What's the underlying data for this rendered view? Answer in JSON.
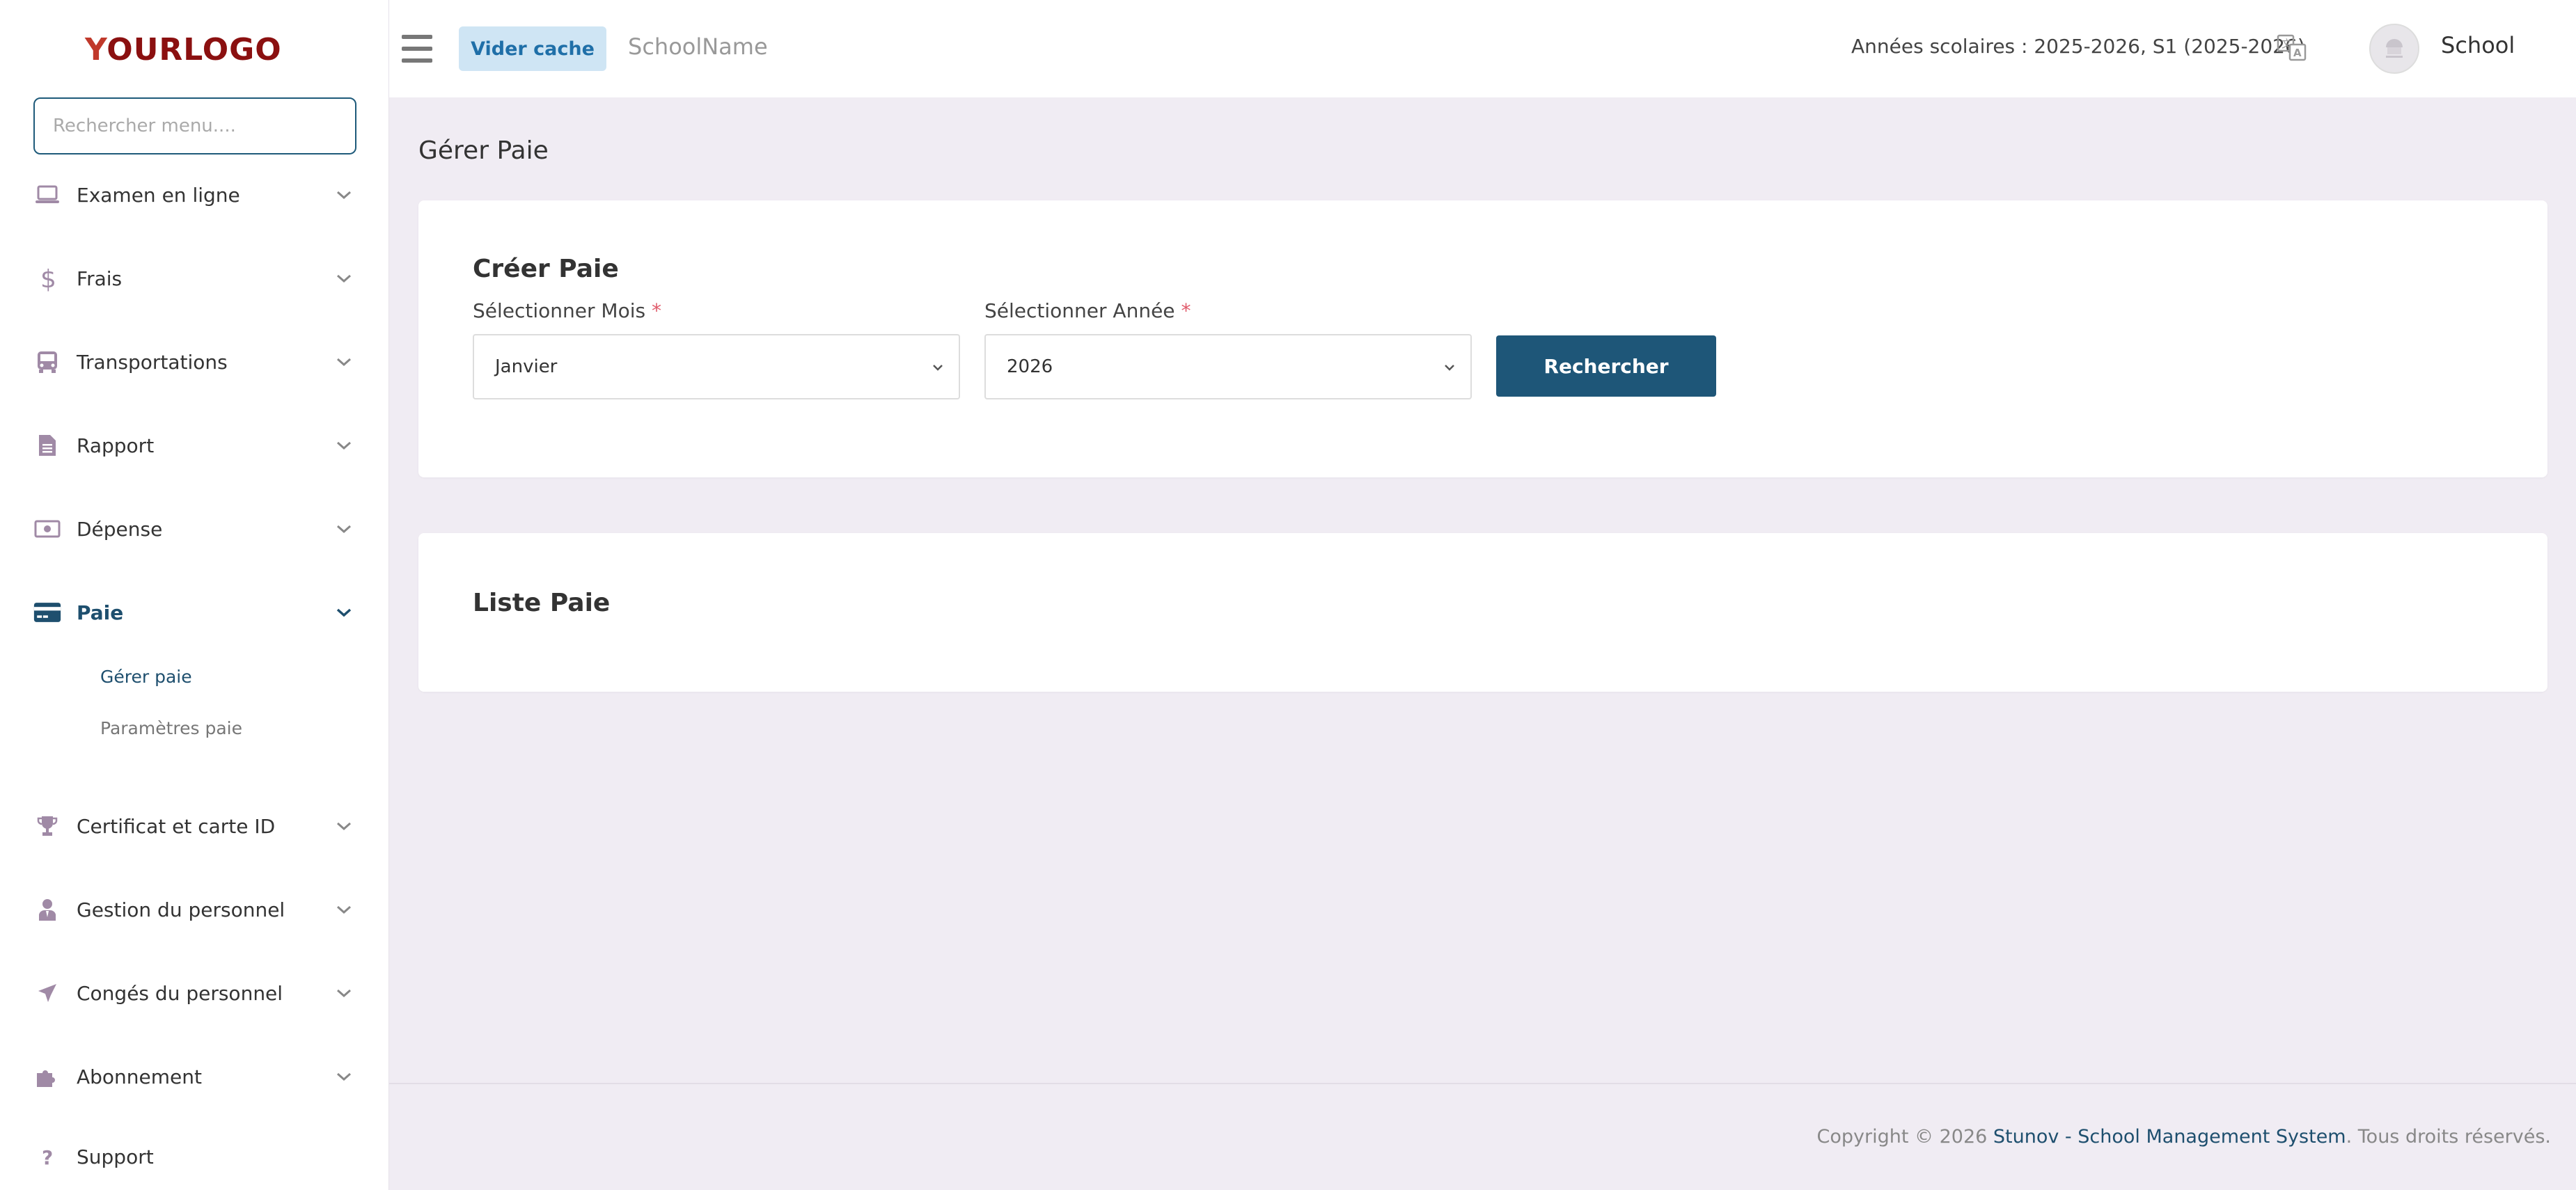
{
  "logo": {
    "first_letter": "Y",
    "rest": "OURLOGO"
  },
  "sidebar": {
    "search_placeholder": "Rechercher menu....",
    "items": [
      {
        "label": "Examen en ligne",
        "icon": "laptop-icon"
      },
      {
        "label": "Frais",
        "icon": "dollar-icon"
      },
      {
        "label": "Transportations",
        "icon": "bus-icon"
      },
      {
        "label": "Rapport",
        "icon": "document-icon"
      },
      {
        "label": "Dépense",
        "icon": "money-bill-icon"
      },
      {
        "label": "Paie",
        "icon": "credit-card-icon",
        "active": true
      },
      {
        "label": "Certificat et carte ID",
        "icon": "trophy-icon"
      },
      {
        "label": "Gestion du personnel",
        "icon": "user-tie-icon"
      },
      {
        "label": "Congés du personnel",
        "icon": "plane-icon"
      },
      {
        "label": "Abonnement",
        "icon": "puzzle-icon"
      },
      {
        "label": "Support",
        "icon": "question-icon"
      }
    ],
    "sub_items": [
      {
        "label": "Gérer paie",
        "active": true
      },
      {
        "label": "Paramètres paie"
      }
    ]
  },
  "header": {
    "clear_cache_label": "Vider cache",
    "school_name": "SchoolName",
    "academic_years": "Années scolaires : 2025-2026, S1 (2025-2026)",
    "user_name": "School"
  },
  "main": {
    "page_title": "Gérer Paie",
    "create_card": {
      "title": "Créer Paie",
      "month_label": "Sélectionner Mois",
      "month_value": "Janvier",
      "year_label": "Sélectionner Année",
      "year_value": "2026",
      "required_mark": "*",
      "search_label": "Rechercher"
    },
    "list_card": {
      "title": "Liste Paie"
    }
  },
  "footer": {
    "prefix": "Copyright © 2026 ",
    "brand": "Stunov - School Management System",
    "suffix": ". Tous droits réservés."
  },
  "colors": {
    "accent": "#1e5678",
    "required": "#e05b6b",
    "background": "#f0ecf3",
    "icon": "#a08aa6"
  }
}
